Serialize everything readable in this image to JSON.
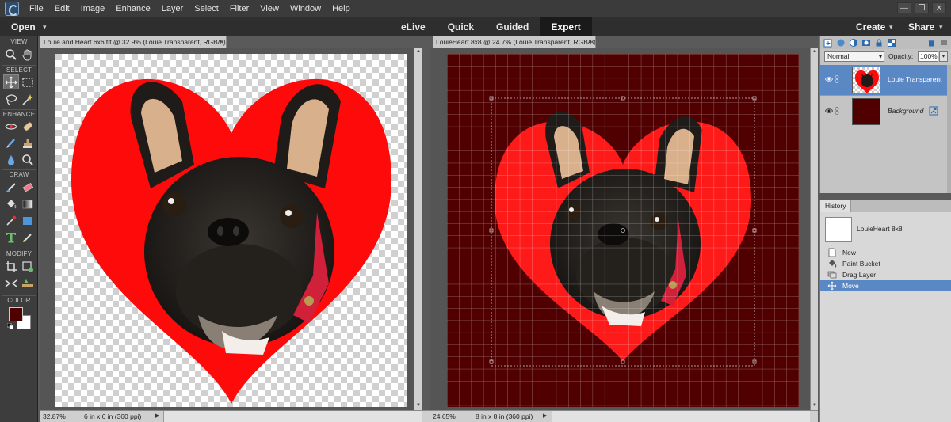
{
  "menu": [
    "File",
    "Edit",
    "Image",
    "Enhance",
    "Layer",
    "Select",
    "Filter",
    "View",
    "Window",
    "Help"
  ],
  "window_controls": {
    "minimize": "—",
    "restore": "❐",
    "close": "✕"
  },
  "modebar": {
    "open_label": "Open",
    "tabs": [
      {
        "label": "eLive",
        "active": false
      },
      {
        "label": "Quick",
        "active": false
      },
      {
        "label": "Guided",
        "active": false
      },
      {
        "label": "Expert",
        "active": true
      }
    ],
    "create_label": "Create",
    "share_label": "Share"
  },
  "toolbox": {
    "sections": [
      "VIEW",
      "SELECT",
      "ENHANCE",
      "DRAW",
      "MODIFY",
      "COLOR"
    ],
    "colors": {
      "foreground": "#500000",
      "background": "#ffffff"
    }
  },
  "documents": [
    {
      "tab_title": "Louie and Heart 6x6.tif @ 32.9% (Louie Transparent, RGB/8)",
      "close": "×",
      "zoom": "32.87%",
      "doc_size": "6 in x 6 in (360 ppi)"
    },
    {
      "tab_title": "LouieHeart 8x8 @ 24.7% (Louie Transparent, RGB/8) *",
      "close": "×",
      "zoom": "24.65%",
      "doc_size": "8 in x 8 in (360 ppi)"
    }
  ],
  "layers_panel": {
    "blend_mode": "Normal",
    "opacity_label": "Opacity:",
    "opacity_value": "100%",
    "layers": [
      {
        "name": "Louie Transparent",
        "selected": true,
        "visible": true
      },
      {
        "name": "Background",
        "selected": false,
        "visible": true,
        "locked": true
      }
    ]
  },
  "history_panel": {
    "tab_label": "History",
    "snapshot_name": "LouieHeart 8x8",
    "items": [
      {
        "label": "New",
        "icon": "new-document-icon",
        "selected": false
      },
      {
        "label": "Paint Bucket",
        "icon": "paint-bucket-icon",
        "selected": false
      },
      {
        "label": "Drag Layer",
        "icon": "drag-layer-icon",
        "selected": false
      },
      {
        "label": "Move",
        "icon": "move-icon",
        "selected": true
      }
    ]
  },
  "colors": {
    "heart_red": "#ff0a0a",
    "maroon_bg": "#500000",
    "selection_blue": "#5a88c4"
  }
}
